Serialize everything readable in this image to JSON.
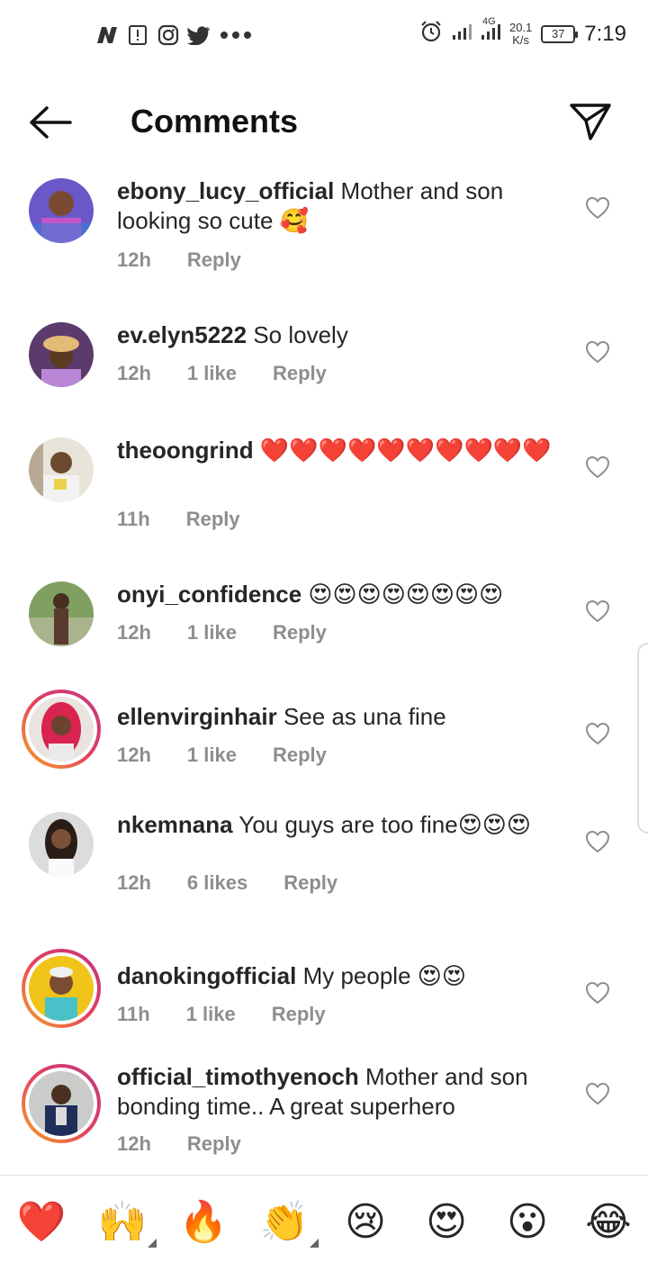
{
  "status_bar": {
    "left_icons": [
      "n-logo-icon",
      "sim-alert-icon",
      "instagram-icon",
      "twitter-icon",
      "more-dots-icon"
    ],
    "network_type": "4G",
    "speed_value": "20.1",
    "speed_unit": "K/s",
    "battery": "37",
    "time": "7:19"
  },
  "header": {
    "title": "Comments",
    "back_icon": "arrow-left-icon",
    "send_icon": "paper-plane-icon"
  },
  "comments": [
    {
      "user": "ebony_lucy_official",
      "text": "Mother and son looking so cute 🥰",
      "time": "12h",
      "likes": "",
      "reply": "Reply",
      "story_ring": false
    },
    {
      "user": "ev.elyn5222",
      "text": "So lovely",
      "time": "12h",
      "likes": "1 like",
      "reply": "Reply",
      "story_ring": false
    },
    {
      "user": "theoongrind",
      "text": "❤️❤️❤️❤️❤️❤️❤️❤️❤️❤️",
      "time": "11h",
      "likes": "",
      "reply": "Reply",
      "story_ring": false
    },
    {
      "user": "onyi_confidence",
      "text": "😍😍😍😍😍😍😍😍",
      "time": "12h",
      "likes": "1 like",
      "reply": "Reply",
      "story_ring": false
    },
    {
      "user": "ellenvirginhair",
      "text": "See as una fine",
      "time": "12h",
      "likes": "1 like",
      "reply": "Reply",
      "story_ring": true
    },
    {
      "user": "nkemnana",
      "text": "You guys are too fine😍😍😍",
      "time": "12h",
      "likes": "6 likes",
      "reply": "Reply",
      "story_ring": false
    },
    {
      "user": "danokingofficial",
      "text": "My people 😍😍",
      "time": "11h",
      "likes": "1 like",
      "reply": "Reply",
      "story_ring": true
    },
    {
      "user": "official_timothyenoch",
      "text": "Mother and son bonding time.. A great superhero",
      "time": "12h",
      "likes": "",
      "reply": "Reply",
      "story_ring": true
    }
  ],
  "reactions": [
    "❤️",
    "🙌",
    "🔥",
    "👏",
    "😢",
    "😍",
    "😮",
    "😂"
  ],
  "colors": {
    "meta_gray": "#8e8e8e",
    "story_ring_start": "#f5a623",
    "story_ring_end": "#c13584",
    "heart_red": "#e0245e"
  }
}
